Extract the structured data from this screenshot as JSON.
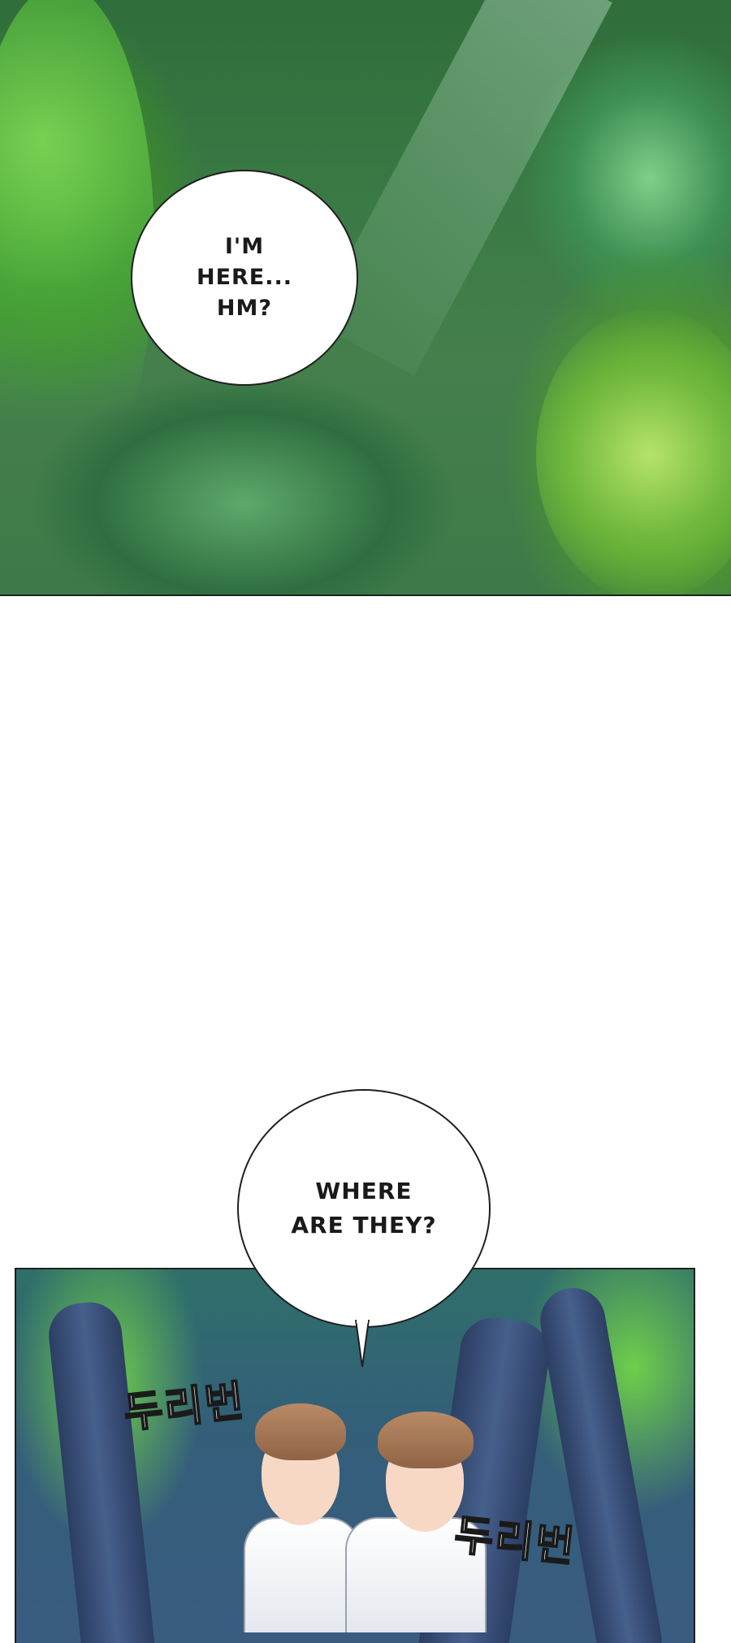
{
  "panels": {
    "top": {
      "bubble_text": "I'M\nHERE...\nHM?"
    },
    "bottom": {
      "bubble_text": "WHERE\nARE THEY?",
      "sfx": [
        "두리번",
        "두리번"
      ]
    }
  }
}
